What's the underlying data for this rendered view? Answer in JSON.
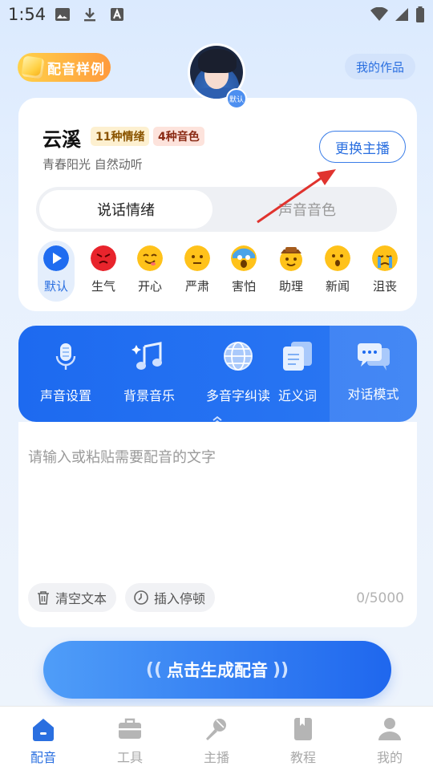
{
  "status_bar": {
    "time": "1:54"
  },
  "header": {
    "sample_label": "配音样例",
    "works_label": "我的作品",
    "default_badge": "默认"
  },
  "host": {
    "name": "云溪",
    "emotion_tag": "11种情绪",
    "tone_tag": "4种音色",
    "description": "青春阳光 自然动听",
    "change_label": "更换主播"
  },
  "segment": {
    "tabs": [
      "说话情绪",
      "声音音色"
    ],
    "selected": "说话情绪"
  },
  "emotions": [
    {
      "label": "默认",
      "icon": "play-icon",
      "selected": true
    },
    {
      "label": "生气",
      "icon": "angry-face-icon",
      "color": "#e8242c"
    },
    {
      "label": "开心",
      "icon": "happy-face-icon",
      "color": "#ffc21a"
    },
    {
      "label": "严肃",
      "icon": "neutral-face-icon",
      "color": "#ffc21a"
    },
    {
      "label": "害怕",
      "icon": "scared-face-icon",
      "color": "#ffc21a"
    },
    {
      "label": "助理",
      "icon": "cowboy-face-icon",
      "color": "#ffc21a"
    },
    {
      "label": "新闻",
      "icon": "surprised-face-icon",
      "color": "#ffc21a"
    },
    {
      "label": "沮丧",
      "icon": "crying-face-icon",
      "color": "#ffc21a"
    }
  ],
  "tools": [
    {
      "label": "声音设置",
      "icon": "microphone-icon"
    },
    {
      "label": "背景音乐",
      "icon": "music-note-icon"
    },
    {
      "label": "多音字纠读",
      "icon": "globe-icon"
    },
    {
      "label": "近义词",
      "icon": "synonym-icon"
    },
    {
      "label": "对话模式",
      "icon": "chat-bubble-icon"
    }
  ],
  "editor": {
    "placeholder": "请输入或粘贴需要配音的文字",
    "clear_label": "清空文本",
    "pause_label": "插入停顿",
    "counter": "0/5000"
  },
  "generate": {
    "label": "点击生成配音",
    "left_wave": "((",
    "right_wave": "))"
  },
  "bottom_nav": [
    {
      "label": "配音",
      "icon": "home-icon",
      "active": true
    },
    {
      "label": "工具",
      "icon": "toolbox-icon"
    },
    {
      "label": "主播",
      "icon": "microphone-icon"
    },
    {
      "label": "教程",
      "icon": "book-icon"
    },
    {
      "label": "我的",
      "icon": "user-icon"
    }
  ],
  "colors": {
    "accent": "#2a6fe0",
    "tools_bg": "#1d6af0",
    "annotation_arrow": "#e0332e"
  }
}
